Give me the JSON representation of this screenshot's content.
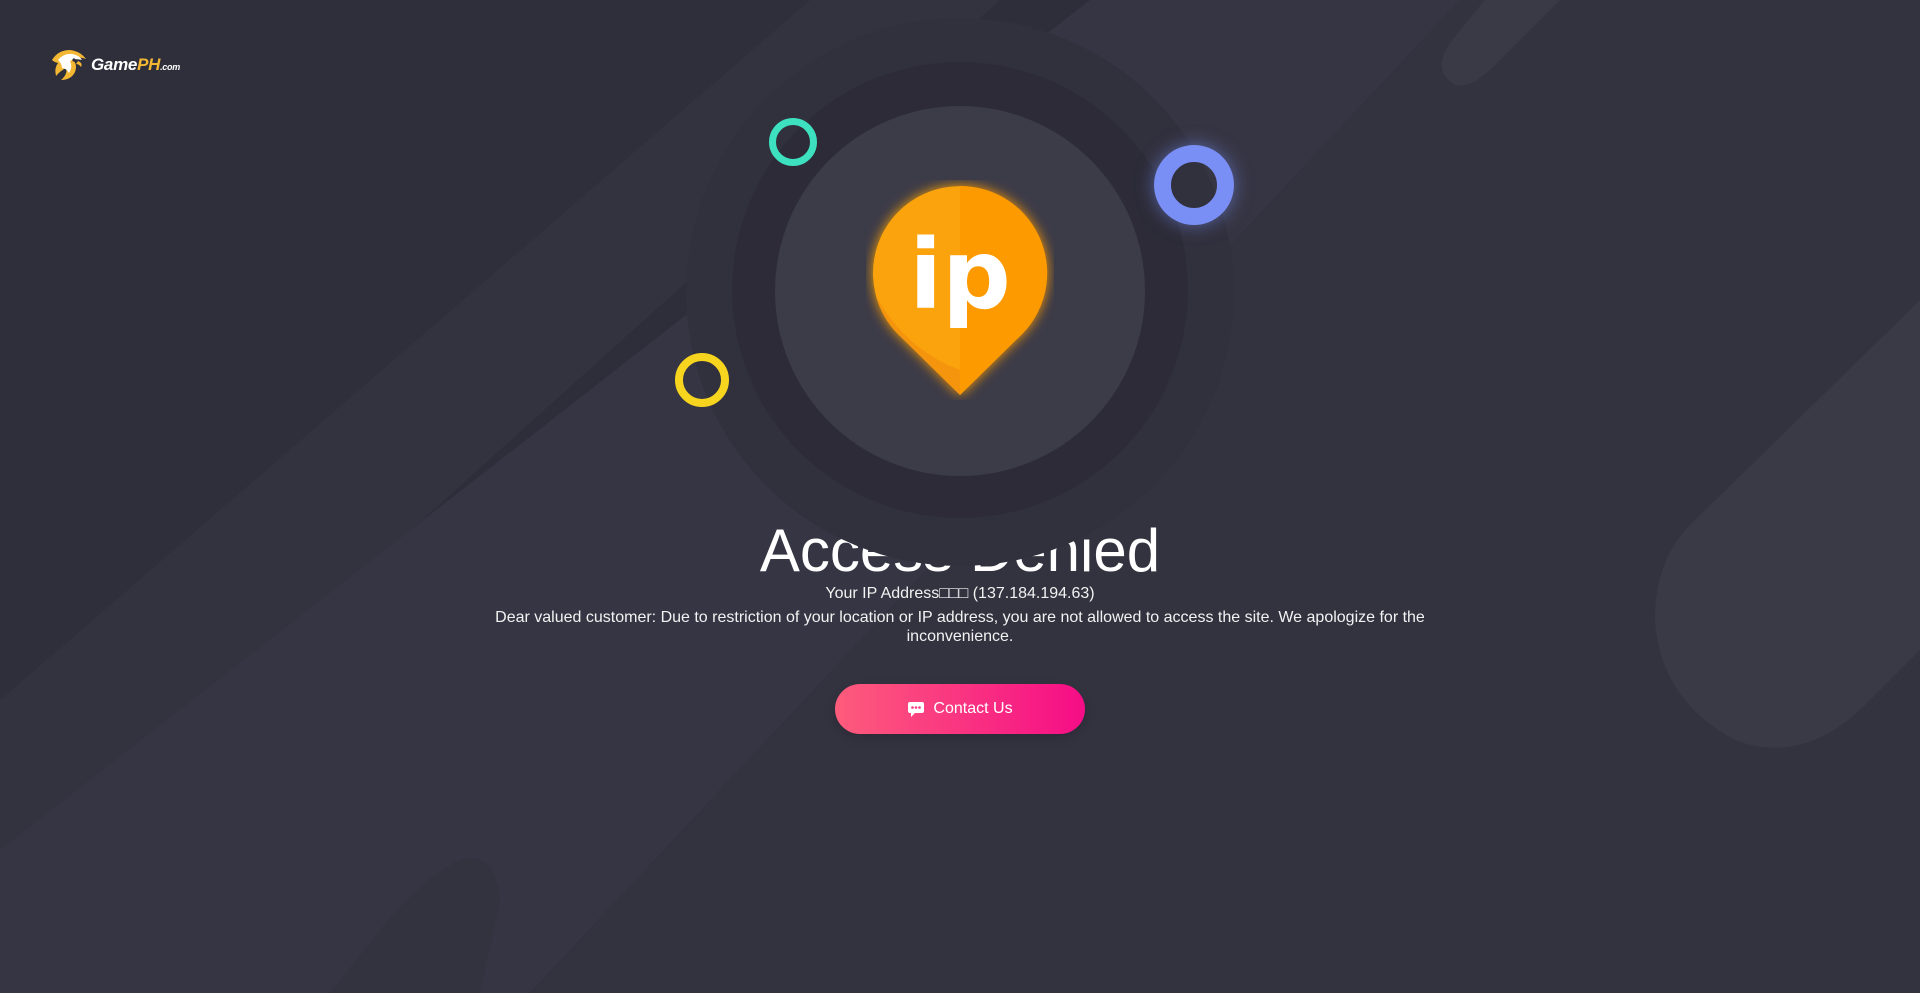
{
  "brand": {
    "name_main": "Game",
    "name_accent": "PH",
    "name_suffix": ".com",
    "icon": "eagle-logo-icon",
    "accent_color": "#f3b734"
  },
  "hero": {
    "badge_icon": "ip-location-pin-icon",
    "badge_text": "ip",
    "badge_color": "#fba30f"
  },
  "content": {
    "title": "Access Denied",
    "ip_label": "Your IP Address□□□",
    "ip_value": "(137.184.194.63)",
    "message": "Dear valued customer: Due to restriction of your location or IP address, you are not allowed to access the site. We apologize for the inconvenience."
  },
  "actions": {
    "contact_label": "Contact Us",
    "contact_icon": "chat-bubble-icon",
    "contact_colors": [
      "#fd5c7c",
      "#f60d86"
    ]
  },
  "decorations": {
    "circle_colors": [
      "#3de0bf",
      "#7a8ff5",
      "#f7d51f"
    ]
  }
}
